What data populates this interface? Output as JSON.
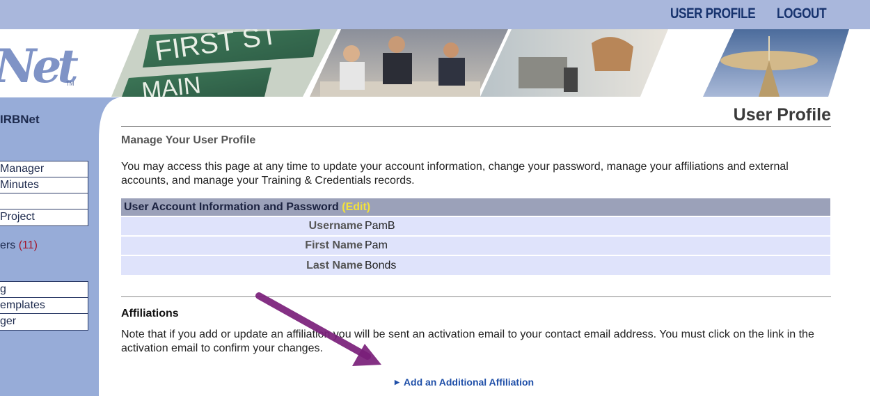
{
  "nav": {
    "user_profile": "USER PROFILE",
    "logout": "LOGOUT"
  },
  "logo": {
    "text": "Net",
    "tm": "TM"
  },
  "banner": {
    "sign_text_1": "FIRST ST",
    "sign_text_2": "MAIN"
  },
  "sidebar": {
    "title": "IRBNet",
    "group1": [
      "Manager",
      "Minutes",
      "",
      "Project"
    ],
    "letters_label": "ers",
    "letters_count": "(11)",
    "group2": [
      "g",
      "emplates",
      "ger"
    ]
  },
  "main": {
    "page_title": "User Profile",
    "section_head": "Manage Your User Profile",
    "intro": "You may access this page at any time to update your account information, change your password, manage your affiliations and external accounts, and manage your Training & Credentials records.",
    "account": {
      "header": "User Account Information and Password",
      "edit": "(Edit)",
      "rows": [
        {
          "label": "Username",
          "value": "PamB"
        },
        {
          "label": "First Name",
          "value": "Pam"
        },
        {
          "label": "Last Name",
          "value": "Bonds"
        }
      ]
    },
    "affiliations": {
      "title": "Affiliations",
      "note": "Note that if you add or update an affiliation you will be sent an activation email to your contact email address. You must click on the link in the activation email to confirm your changes.",
      "add_link": "Add an Additional Affiliation"
    }
  },
  "colors": {
    "topbar": "#a9b7dc",
    "sidebar": "#97acd8",
    "table_header": "#9ba1b9",
    "table_row": "#dfe3fb",
    "edit_link": "#f3e23a",
    "annotation_arrow": "#7a1f7a"
  }
}
